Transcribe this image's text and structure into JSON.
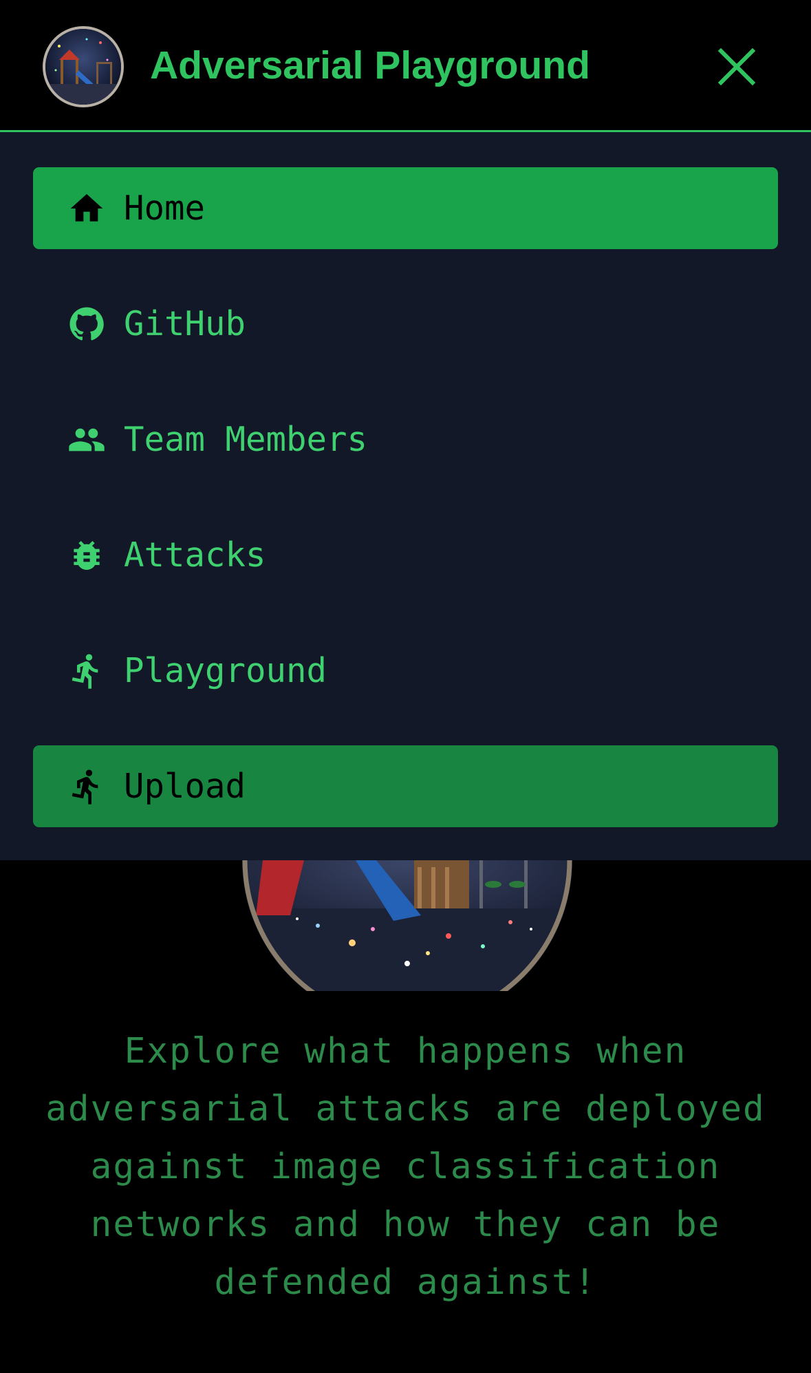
{
  "header": {
    "title": "Adversarial Playground",
    "logo_icon": "playground-logo-icon",
    "close_icon": "close-icon"
  },
  "menu": {
    "items": [
      {
        "label": "Home",
        "icon": "home-icon",
        "highlighted": true
      },
      {
        "label": "GitHub",
        "icon": "github-icon",
        "highlighted": false
      },
      {
        "label": "Team Members",
        "icon": "people-icon",
        "highlighted": false
      },
      {
        "label": "Attacks",
        "icon": "bug-icon",
        "highlighted": false
      },
      {
        "label": "Playground",
        "icon": "running-person-icon",
        "highlighted": false
      },
      {
        "label": "Upload",
        "icon": "running-person-icon",
        "highlighted": true
      }
    ]
  },
  "main": {
    "tagline": "Explore what happens when adversarial attacks are deployed against image classification networks and how they can be defended against!"
  },
  "colors": {
    "accent": "#2fc460",
    "active_home_bg": "#19a34a",
    "active_upload_bg": "#188641",
    "menu_bg": "#121828",
    "page_bg": "#000000",
    "tagline": "#2c8a4a"
  }
}
